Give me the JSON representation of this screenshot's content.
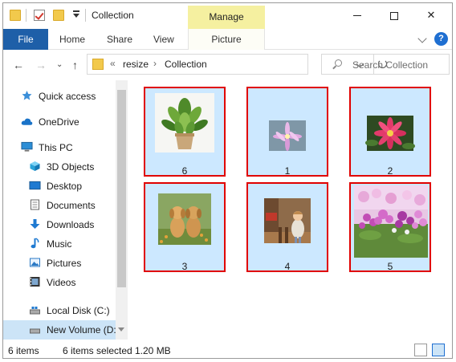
{
  "window": {
    "title": "Collection",
    "contextual_tab": "Manage",
    "controls": {
      "minimize": "",
      "maximize": "",
      "close": "✕"
    }
  },
  "ribbon": {
    "tabs": [
      "File",
      "Home",
      "Share",
      "View",
      "Picture Tools"
    ],
    "help": "?"
  },
  "address": {
    "overflow": "«",
    "segments": [
      "resize",
      "Collection"
    ],
    "separator": "›"
  },
  "search": {
    "placeholder": "Search Collection"
  },
  "nav_pane": {
    "items": [
      {
        "label": "Quick access",
        "icon": "star-icon"
      },
      {
        "label": "OneDrive",
        "icon": "cloud-icon"
      },
      {
        "label": "This PC",
        "icon": "computer-icon"
      },
      {
        "label": "3D Objects",
        "icon": "cube-icon"
      },
      {
        "label": "Desktop",
        "icon": "desktop-icon"
      },
      {
        "label": "Documents",
        "icon": "document-icon"
      },
      {
        "label": "Downloads",
        "icon": "download-icon"
      },
      {
        "label": "Music",
        "icon": "music-icon"
      },
      {
        "label": "Pictures",
        "icon": "pictures-icon"
      },
      {
        "label": "Videos",
        "icon": "videos-icon"
      },
      {
        "label": "Local Disk (C:)",
        "icon": "drive-icon"
      },
      {
        "label": "New Volume (D:",
        "icon": "drive-icon"
      }
    ],
    "selected_index": 11
  },
  "files": [
    {
      "name": "6",
      "image": "plant-photo"
    },
    {
      "name": "1",
      "image": "pink-flower-photo"
    },
    {
      "name": "2",
      "image": "red-flower-photo"
    },
    {
      "name": "3",
      "image": "puppies-photo"
    },
    {
      "name": "4",
      "image": "child-photo"
    },
    {
      "name": "5",
      "image": "flower-field-photo"
    }
  ],
  "status": {
    "item_count": "6 items",
    "selection": "6 items selected",
    "size": "1.20 MB"
  },
  "colors": {
    "selection_fill": "#cce8ff",
    "highlight_border": "#e00000",
    "file_tab": "#1e5fa8",
    "manage_tab": "#f5f0a0"
  }
}
